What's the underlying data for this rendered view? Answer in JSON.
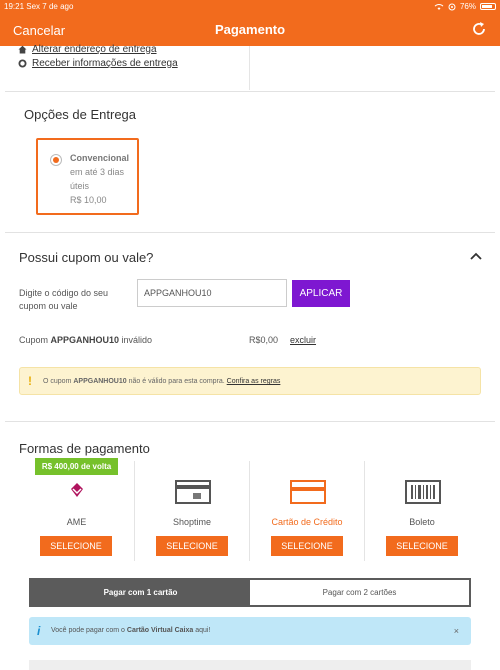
{
  "status_bar": {
    "time": "19:21",
    "date": "Sex 7 de ago",
    "battery": "76%"
  },
  "header": {
    "cancel_label": "Cancelar",
    "title": "Pagamento"
  },
  "address_links": {
    "change_address": "Alterar endereço de entrega",
    "receive_info": "Receber informações de entrega"
  },
  "delivery": {
    "heading": "Opções de Entrega",
    "option": {
      "name": "Convencional",
      "time_line1": "em até 3 dias",
      "time_line2": "úteis",
      "price": "R$ 10,00"
    }
  },
  "coupon": {
    "heading": "Possui cupom ou vale?",
    "input_label": "Digite o código do seu cupom ou vale",
    "input_value": "APPGANHOU10",
    "apply_label": "APLICAR",
    "status_prefix": "Cupom ",
    "status_code": "APPGANHOU10",
    "status_suffix": " inválido",
    "value": "R$0,00",
    "remove_label": "excluir",
    "warning_prefix": "O cupom ",
    "warning_code": "APPGANHOU10",
    "warning_suffix": " não é válido para esta compra. ",
    "warning_link": "Confira as regras"
  },
  "payment": {
    "heading": "Formas de pagamento",
    "cashback_badge": "R$ 400,00 de volta",
    "methods": [
      {
        "label": "AME",
        "button": "SELECIONE"
      },
      {
        "label": "Shoptime",
        "button": "SELECIONE"
      },
      {
        "label": "Cartão de Crédito",
        "button": "SELECIONE"
      },
      {
        "label": "Boleto",
        "button": "SELECIONE"
      }
    ],
    "card_tabs": {
      "one": "Pagar com 1 cartão",
      "two": "Pagar com 2 cartões"
    },
    "info_prefix": "Você pode pagar com o ",
    "info_bold": "Cartão Virtual Caixa",
    "info_suffix": " aqui!",
    "info_close": "×"
  },
  "colors": {
    "brand": "#f26b1d",
    "apply": "#7e17d1",
    "cashback": "#76c12b"
  }
}
